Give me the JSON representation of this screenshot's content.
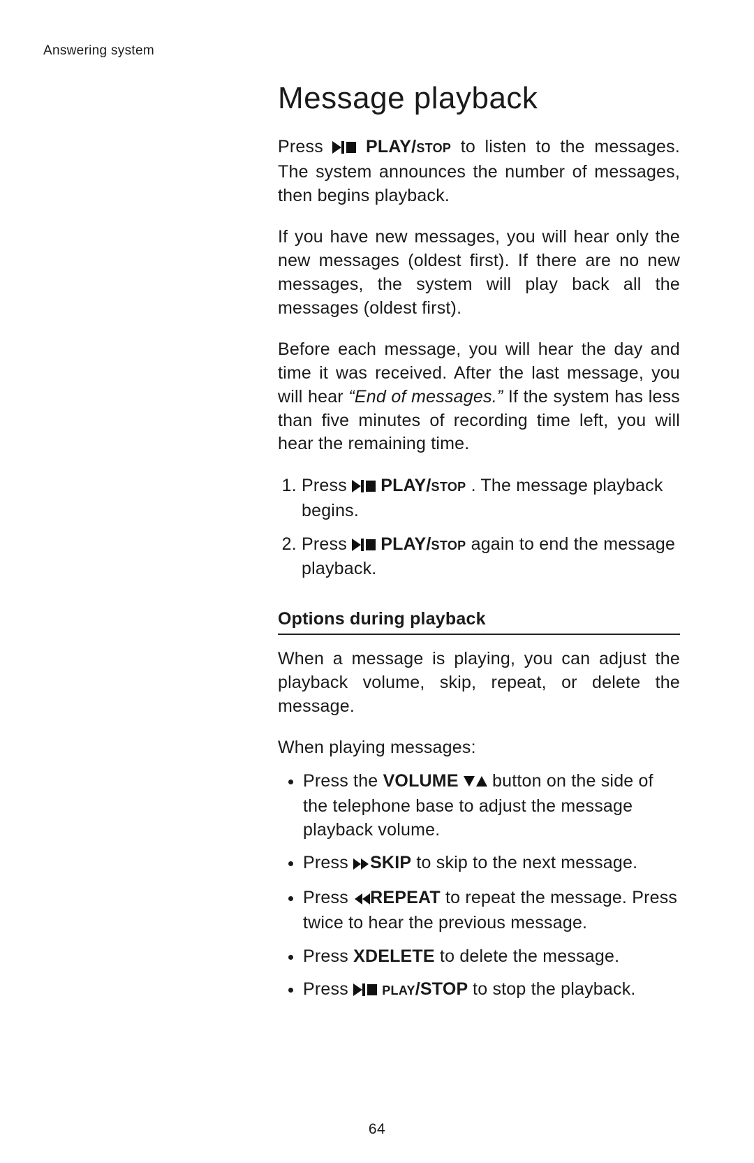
{
  "running_head": "Answering system",
  "title": "Message playback",
  "intro_1_before": "Press ",
  "intro_1_after": " to listen to the messages. The system announces the number of messages, then begins playback.",
  "para2": "If you have new messages, you will hear only the new messages (oldest first). If there are no new messages, the system will play back all the messages (oldest first).",
  "para3_before": "Before each message, you will hear the day and time it was received. After the last message, you will hear ",
  "para3_quote": "“End of messages.”",
  "para3_after": " If the system has less than five minutes of recording time left, you will hear the remaining time.",
  "step1_before": "Press ",
  "step1_after": ". The message playback begins.",
  "step2_before": "Press ",
  "step2_after": " again to end the message playback.",
  "playstop_play": "PLAY/",
  "playstop_stop": "stop",
  "playstop_play_sc": "play",
  "playstop_stop_up": "/STOP",
  "subhead": "Options during playback",
  "opt_intro": "When a message is playing, you can adjust the playback volume, skip, repeat, or delete the message.",
  "opt_lead": "When playing messages:",
  "b1_before": "Press the ",
  "b1_vol": "VOLUME",
  "b1_after": " button on the side of the telephone base to adjust the message playback volume.",
  "b2_before": "Press ",
  "b2_skip": "SKIP",
  "b2_after": " to skip to the next message.",
  "b3_before": "Press ",
  "b3_repeat": "REPEAT",
  "b3_after": " to repeat the message. Press twice to hear the previous message.",
  "b4_before": "Press ",
  "b4_x": "X",
  "b4_delete": "DELETE",
  "b4_after": " to delete the message.",
  "b5_before": "Press ",
  "b5_after": " to stop the playback.",
  "page_number": "64",
  "icons": {
    "play_stop": "play-stop-icon",
    "vol": "volume-down-up-icon",
    "ffwd": "fast-forward-icon",
    "rew": "rewind-icon"
  }
}
